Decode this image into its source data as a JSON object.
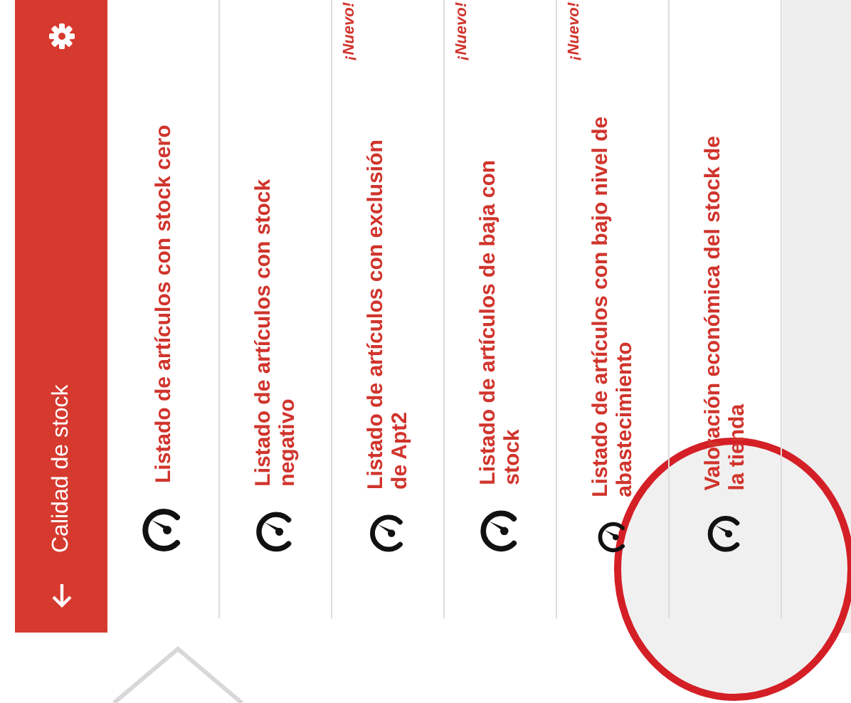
{
  "header": {
    "title": "Calidad de stock"
  },
  "rows": [
    {
      "label": "Listado de artículos con stock cero"
    },
    {
      "label": "Listado de artículos con stock negativo"
    },
    {
      "label": "Listado de artículos con exclusión de Apt2",
      "badge": "¡Nuevo!"
    },
    {
      "label": "Listado de artículos de baja con stock",
      "badge": "¡Nuevo!"
    },
    {
      "label": "Listado de artículos con bajo nivel de abastecimiento",
      "badge": "¡Nuevo!"
    },
    {
      "label": "Valoración económica del stock de la tienda"
    }
  ],
  "annotation": {
    "kind": "circle"
  }
}
